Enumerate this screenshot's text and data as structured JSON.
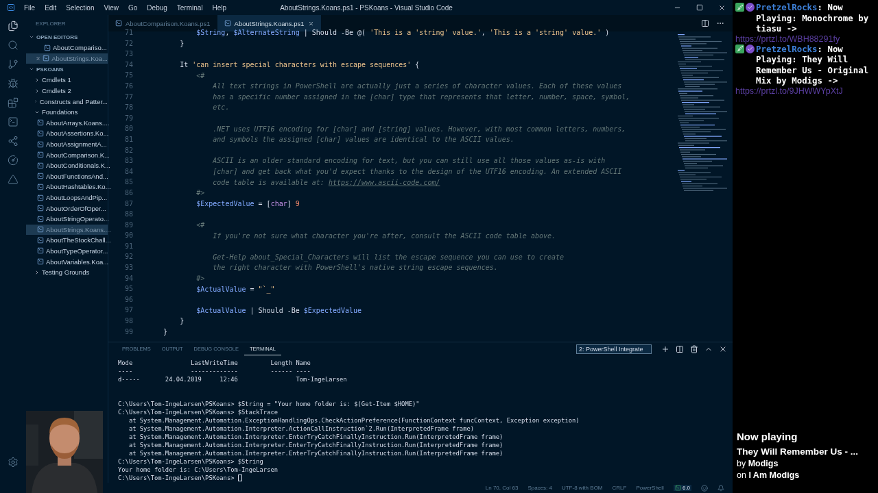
{
  "window": {
    "title": "AboutStrings.Koans.ps1 - PSKoans - Visual Studio Code"
  },
  "menu": [
    "File",
    "Edit",
    "Selection",
    "View",
    "Go",
    "Debug",
    "Terminal",
    "Help"
  ],
  "sidebar": {
    "title": "EXPLORER",
    "sections": [
      {
        "label": "OPEN EDITORS",
        "expanded": true,
        "items": [
          {
            "label": "AboutCompariso...",
            "selected": false,
            "closable": false
          },
          {
            "label": "AboutStrings.Koa...",
            "selected": true,
            "closable": true
          }
        ]
      },
      {
        "label": "PSKOANS",
        "expanded": true,
        "tree": [
          {
            "label": "Cmdlets 1",
            "kind": "folder",
            "expanded": false
          },
          {
            "label": "Cmdlets 2",
            "kind": "folder",
            "expanded": false
          },
          {
            "label": "Constructs and Patter...",
            "kind": "folder",
            "expanded": false
          },
          {
            "label": "Foundations",
            "kind": "folder",
            "expanded": true,
            "children": [
              {
                "label": "AboutArrays.Koans....",
                "kind": "file",
                "selected": false
              },
              {
                "label": "AboutAssertions.Ko...",
                "kind": "file",
                "selected": false
              },
              {
                "label": "AboutAssignmentA...",
                "kind": "file",
                "selected": false
              },
              {
                "label": "AboutComparison.K...",
                "kind": "file",
                "selected": false
              },
              {
                "label": "AboutConditionals.K...",
                "kind": "file",
                "selected": false
              },
              {
                "label": "AboutFunctionsAnd...",
                "kind": "file",
                "selected": false
              },
              {
                "label": "AboutHashtables.Ko...",
                "kind": "file",
                "selected": false
              },
              {
                "label": "AboutLoopsAndPip...",
                "kind": "file",
                "selected": false
              },
              {
                "label": "AboutOrderOfOper...",
                "kind": "file",
                "selected": false
              },
              {
                "label": "AboutStringOperato...",
                "kind": "file",
                "selected": false
              },
              {
                "label": "AboutStrings.Koans....",
                "kind": "file",
                "selected": true
              },
              {
                "label": "AboutTheStockChall...",
                "kind": "file",
                "selected": false
              },
              {
                "label": "AboutTypeOperator...",
                "kind": "file",
                "selected": false
              },
              {
                "label": "AboutVariables.Koa...",
                "kind": "file",
                "selected": false
              }
            ]
          },
          {
            "label": "Testing Grounds",
            "kind": "folder",
            "expanded": false
          }
        ]
      }
    ]
  },
  "tabs": [
    {
      "label": "AboutComparison.Koans.ps1",
      "selected": false
    },
    {
      "label": "AboutStrings.Koans.ps1",
      "selected": true
    }
  ],
  "editor": {
    "lines": [
      {
        "number": "71",
        "segments": [
          {
            "text": "            $String",
            "kind": "variable"
          },
          {
            "text": ", ",
            "kind": "plain"
          },
          {
            "text": "$AlternateString",
            "kind": "variable"
          },
          {
            "text": " | Should -Be @( ",
            "kind": "plain"
          },
          {
            "text": "'This is a 'string' value.'",
            "kind": "string"
          },
          {
            "text": ", ",
            "kind": "plain"
          },
          {
            "text": "'This is a 'string' value.'",
            "kind": "string"
          },
          {
            "text": " )",
            "kind": "plain"
          }
        ]
      },
      {
        "number": "72",
        "segments": [
          {
            "text": "        }",
            "kind": "plain"
          }
        ]
      },
      {
        "number": "73"
      },
      {
        "number": "74",
        "segments": [
          {
            "text": "        It ",
            "kind": "plain"
          },
          {
            "text": "'can insert special characters with escape sequences'",
            "kind": "string"
          },
          {
            "text": " {",
            "kind": "plain"
          }
        ]
      },
      {
        "number": "75",
        "segments": [
          {
            "text": "            <#",
            "kind": "comment"
          }
        ]
      },
      {
        "number": "76",
        "segments": [
          {
            "text": "                All text strings in PowerShell are actually just a series of character values. Each of these values",
            "kind": "comment"
          }
        ]
      },
      {
        "number": "77",
        "segments": [
          {
            "text": "                has a specific number assigned in the [char] type that represents that letter, number, space, symbol,",
            "kind": "comment"
          }
        ]
      },
      {
        "number": "78",
        "segments": [
          {
            "text": "                etc.",
            "kind": "comment"
          }
        ]
      },
      {
        "number": "79"
      },
      {
        "number": "80",
        "segments": [
          {
            "text": "                .NET uses UTF16 encoding for [char] and [string] values. However, with most common letters, numbers,",
            "kind": "comment"
          }
        ]
      },
      {
        "number": "81",
        "segments": [
          {
            "text": "                and symbols the assigned [char] values are identical to the ASCII values.",
            "kind": "comment"
          }
        ]
      },
      {
        "number": "82"
      },
      {
        "number": "83",
        "segments": [
          {
            "text": "                ASCII is an older standard encoding for text, but you can still use all those values as-is with",
            "kind": "comment"
          }
        ]
      },
      {
        "number": "84",
        "segments": [
          {
            "text": "                [char] and get back what you'd expect thanks to the design of the UTF16 encoding. An extended ASCII",
            "kind": "comment"
          }
        ]
      },
      {
        "number": "85",
        "segments": [
          {
            "text": "                code table is available at: ",
            "kind": "comment"
          },
          {
            "text": "https://www.ascii-code.com/",
            "kind": "link"
          }
        ]
      },
      {
        "number": "86",
        "segments": [
          {
            "text": "            #>",
            "kind": "comment"
          }
        ]
      },
      {
        "number": "87",
        "segments": [
          {
            "text": "            $ExpectedValue",
            "kind": "variable"
          },
          {
            "text": " = [",
            "kind": "plain"
          },
          {
            "text": "char",
            "kind": "type"
          },
          {
            "text": "] ",
            "kind": "plain"
          },
          {
            "text": "9",
            "kind": "number"
          }
        ]
      },
      {
        "number": "88"
      },
      {
        "number": "89",
        "segments": [
          {
            "text": "            <#",
            "kind": "comment"
          }
        ]
      },
      {
        "number": "90",
        "segments": [
          {
            "text": "                If you're not sure what character you're after, consult the ASCII code table above.",
            "kind": "comment"
          }
        ]
      },
      {
        "number": "91"
      },
      {
        "number": "92",
        "segments": [
          {
            "text": "                Get-Help about_Special_Characters will list the escape sequence you can use to create",
            "kind": "comment"
          }
        ]
      },
      {
        "number": "93",
        "segments": [
          {
            "text": "                the right character with PowerShell's native string escape sequences.",
            "kind": "comment"
          }
        ]
      },
      {
        "number": "94",
        "segments": [
          {
            "text": "            #>",
            "kind": "comment"
          }
        ]
      },
      {
        "number": "95",
        "segments": [
          {
            "text": "            $ActualValue",
            "kind": "variable"
          },
          {
            "text": " = ",
            "kind": "plain"
          },
          {
            "text": "\"`_\"",
            "kind": "string"
          }
        ]
      },
      {
        "number": "96"
      },
      {
        "number": "97",
        "segments": [
          {
            "text": "            $ActualValue",
            "kind": "variable"
          },
          {
            "text": " | Should -Be ",
            "kind": "plain"
          },
          {
            "text": "$ExpectedValue",
            "kind": "variable"
          }
        ]
      },
      {
        "number": "98",
        "segments": [
          {
            "text": "        }",
            "kind": "plain"
          }
        ]
      },
      {
        "number": "99",
        "segments": [
          {
            "text": "    }",
            "kind": "plain"
          }
        ]
      }
    ]
  },
  "panel": {
    "tabs": [
      {
        "label": "PROBLEMS",
        "selected": false
      },
      {
        "label": "OUTPUT",
        "selected": false
      },
      {
        "label": "DEBUG CONSOLE",
        "selected": false
      },
      {
        "label": "TERMINAL",
        "selected": true
      }
    ],
    "terminal_select": "2: PowerShell Integrate",
    "terminal": {
      "cursor": true,
      "blocks": [
        [
          "Mode                LastWriteTime         Length Name",
          "----                -------------         ------ ----",
          "d-----       24.04.2019     12:46                Tom-IngeLarsen"
        ],
        [
          "C:\\Users\\Tom-IngeLarsen\\PSKoans> $String = \"Your home folder is: $(Get-Item $HOME)\"",
          "C:\\Users\\Tom-IngeLarsen\\PSKoans> $StackTrace",
          "   at System.Management.Automation.ExceptionHandlingOps.CheckActionPreference(FunctionContext funcContext, Exception exception)",
          "   at System.Management.Automation.Interpreter.ActionCallInstruction`2.Run(InterpretedFrame frame)",
          "   at System.Management.Automation.Interpreter.EnterTryCatchFinallyInstruction.Run(InterpretedFrame frame)",
          "   at System.Management.Automation.Interpreter.EnterTryCatchFinallyInstruction.Run(InterpretedFrame frame)",
          "   at System.Management.Automation.Interpreter.EnterTryCatchFinallyInstruction.Run(InterpretedFrame frame)",
          "C:\\Users\\Tom-IngeLarsen\\PSKoans> $String",
          "Your home folder is: C:\\Users\\Tom-IngeLarsen",
          "C:\\Users\\Tom-IngeLarsen\\PSKoans> "
        ]
      ]
    }
  },
  "status_bar": {
    "items": [
      "Ln 70, Col 63",
      "Spaces: 4",
      "UTF-8 with BOM",
      "CRLF",
      "PowerShell"
    ],
    "version": "6.0"
  },
  "chat": {
    "messages": [
      {
        "user": "PretzelRocks",
        "text": ": Now Playing: Monochrome by tiasu ->",
        "link": "https://prtzl.to/WBH88291fy"
      },
      {
        "user": "PretzelRocks",
        "text": ": Now Playing: They Will Remember Us - Original Mix by Modigs ->",
        "link": "https://prtzl.to/9JHWWYpXtJ"
      }
    ]
  },
  "now_playing": {
    "heading": "Now playing",
    "track": "They Will Remember Us - ...",
    "artist": "by **Modigs**",
    "album": "on **I Am Modigs**"
  }
}
